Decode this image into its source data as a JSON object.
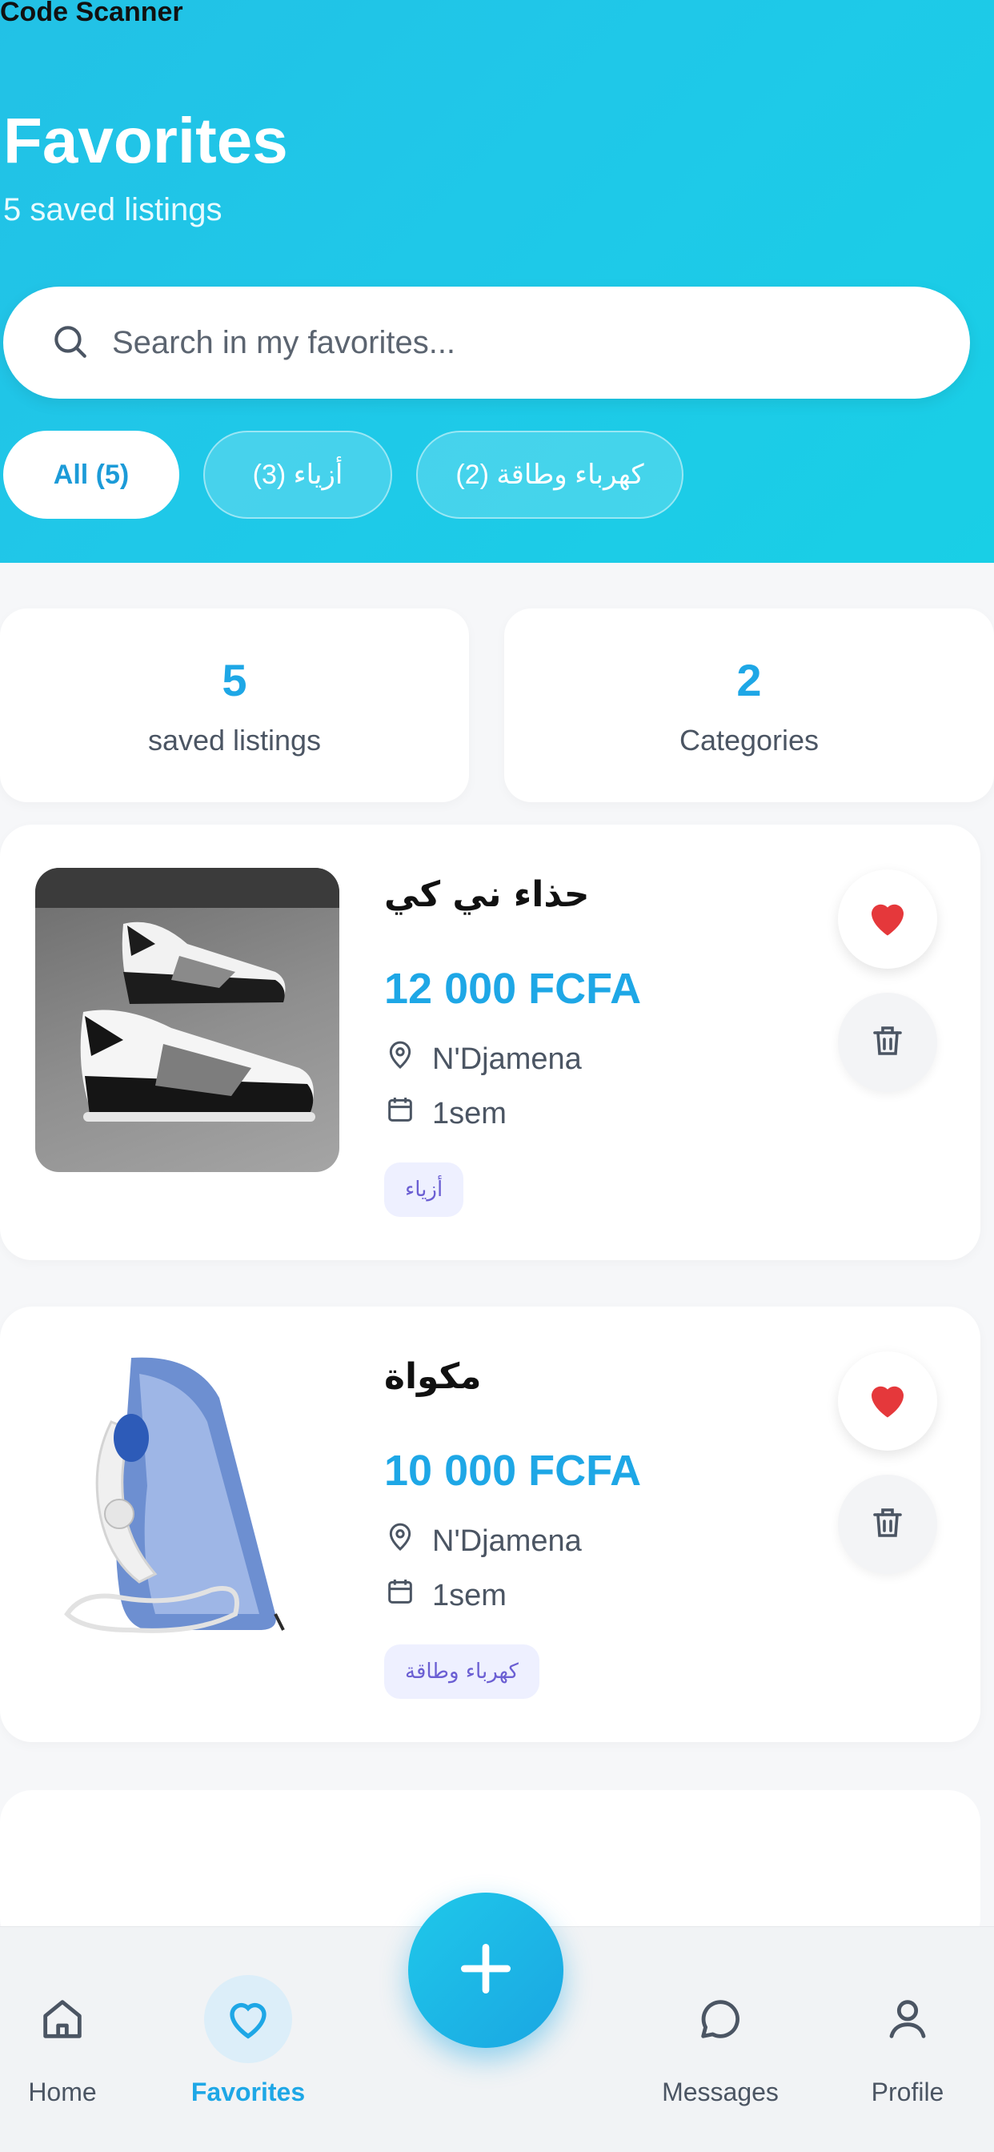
{
  "status_bar": {
    "app_label": "Code Scanner"
  },
  "header": {
    "title": "Favorites",
    "subtitle": "5 saved listings"
  },
  "search": {
    "placeholder": "Search in my favorites..."
  },
  "filters": [
    {
      "label": "All (5)",
      "active": true
    },
    {
      "label": "أزياء (3)",
      "active": false
    },
    {
      "label": "كهرباء وطاقة (2)",
      "active": false
    }
  ],
  "stats": [
    {
      "value": "5",
      "label": "saved listings"
    },
    {
      "value": "2",
      "label": "Categories"
    }
  ],
  "listings": [
    {
      "title": "حذاء ني كي",
      "price": "12 000 FCFA",
      "location": "N'Djamena",
      "date": "1sem",
      "category": "أزياء",
      "thumbnail_icon": "sneakers-image"
    },
    {
      "title": "مكواة",
      "price": "10 000 FCFA",
      "location": "N'Djamena",
      "date": "1sem",
      "category": "كهرباء وطاقة",
      "thumbnail_icon": "iron-image"
    }
  ],
  "bottom_nav": {
    "items": [
      {
        "label": "Home",
        "icon": "home-icon",
        "active": false
      },
      {
        "label": "Favorites",
        "icon": "heart-icon",
        "active": true
      },
      {
        "label": "Messages",
        "icon": "message-icon",
        "active": false
      },
      {
        "label": "Profile",
        "icon": "user-icon",
        "active": false
      }
    ],
    "fab_icon": "plus-icon"
  },
  "colors": {
    "header_gradient_start": "#22c1e6",
    "header_gradient_end": "#19cfe6",
    "accent": "#1ea7e6",
    "heart_red": "#e5383b",
    "badge_bg": "#eef0ff",
    "badge_text": "#6b5fd3"
  }
}
